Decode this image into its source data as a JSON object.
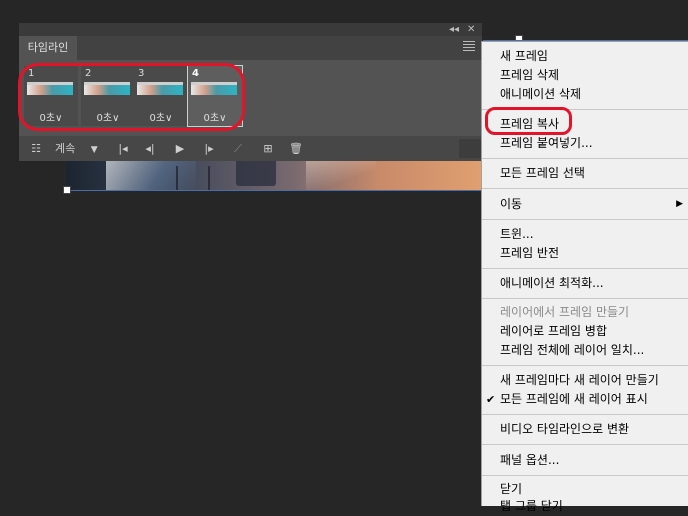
{
  "panel": {
    "tab_label": "타임라인",
    "frames": [
      {
        "number": "1",
        "delay": "0초",
        "selected": false
      },
      {
        "number": "2",
        "delay": "0초",
        "selected": false
      },
      {
        "number": "3",
        "delay": "0초",
        "selected": false
      },
      {
        "number": "4",
        "delay": "0초",
        "selected": true
      }
    ],
    "controls": {
      "loop_label": "계속"
    }
  },
  "menu": {
    "items": [
      {
        "label": "새 프레임"
      },
      {
        "label": "프레임 삭제"
      },
      {
        "label": "애니메이션 삭제"
      },
      {
        "label": "프레임 복사"
      },
      {
        "label": "프레임 붙여넣기..."
      },
      {
        "label": "모든 프레임 선택"
      },
      {
        "label": "이동"
      },
      {
        "label": "트윈..."
      },
      {
        "label": "프레임 반전"
      },
      {
        "label": "애니메이션 최적화..."
      },
      {
        "label": "레이어에서 프레임 만들기"
      },
      {
        "label": "레이어로 프레임 병합"
      },
      {
        "label": "프레임 전체에 레이어 일치..."
      },
      {
        "label": "새 프레임마다 새 레이어 만들기"
      },
      {
        "label": "모든 프레임에 새 레이어 표시"
      },
      {
        "label": "비디오 타임라인으로 변환"
      },
      {
        "label": "패널 옵션..."
      },
      {
        "label": "닫기"
      },
      {
        "label": "탭 그룹 닫기"
      }
    ]
  },
  "colors": {
    "annotation": "#e3142a",
    "panel_bg": "#535353",
    "menu_bg": "#f0f0f0"
  }
}
